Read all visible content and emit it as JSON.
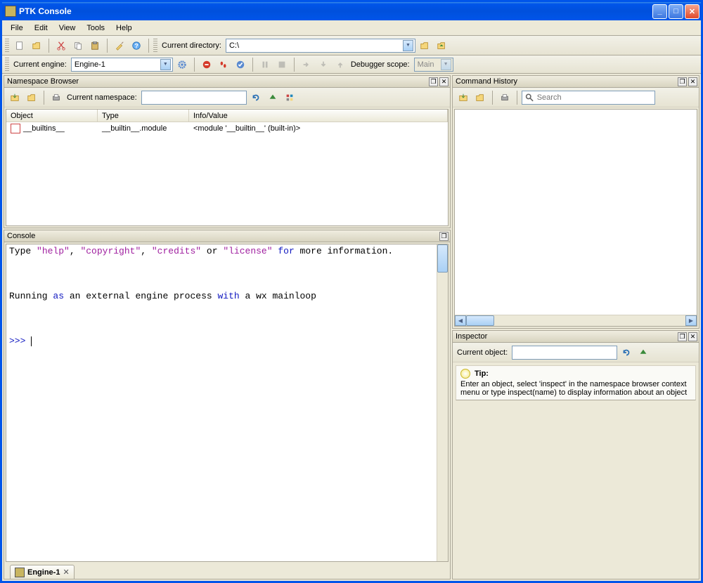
{
  "window": {
    "title": "PTK Console"
  },
  "menubar": [
    "File",
    "Edit",
    "View",
    "Tools",
    "Help"
  ],
  "toolbar1": {
    "current_directory_label": "Current directory:",
    "current_directory_value": "C:\\"
  },
  "toolbar2": {
    "current_engine_label": "Current engine:",
    "current_engine_value": "Engine-1",
    "debugger_scope_label": "Debugger scope:",
    "debugger_scope_value": "Main"
  },
  "namespace_browser": {
    "title": "Namespace Browser",
    "current_namespace_label": "Current namespace:",
    "current_namespace_value": "",
    "columns": [
      "Object",
      "Type",
      "Info/Value"
    ],
    "rows": [
      {
        "object": "__builtins__",
        "type": "__builtin__.module",
        "info": "<module '__builtin__' (built-in)>"
      }
    ]
  },
  "console": {
    "title": "Console",
    "tab_label": "Engine-1",
    "line1_prefix": "Type ",
    "line1_s1": "\"help\"",
    "line1_mid1": ", ",
    "line1_s2": "\"copyright\"",
    "line1_mid2": ", ",
    "line1_s3": "\"credits\"",
    "line1_mid3": " or ",
    "line1_s4": "\"license\"",
    "line1_mid4": " ",
    "line1_kw1": "for",
    "line1_suffix": " more information.",
    "line2_prefix": "Running ",
    "line2_kw1": "as",
    "line2_mid1": " an external engine process ",
    "line2_kw2": "with",
    "line2_suffix": " a wx mainloop",
    "prompt": ">>> "
  },
  "command_history": {
    "title": "Command History",
    "search_placeholder": "Search"
  },
  "inspector": {
    "title": "Inspector",
    "current_object_label": "Current object:",
    "current_object_value": "",
    "tip_label": "Tip:",
    "tip_text": "Enter an object, select 'inspect' in the namespace browser context menu or type inspect(name) to display information about an object"
  },
  "icons": {
    "new": "new-file-icon",
    "open": "open-folder-icon",
    "cut": "cut-icon",
    "copy": "copy-icon",
    "paste": "paste-icon",
    "clear": "clear-icon",
    "help": "help-icon",
    "folder": "folder-icon",
    "folder-up": "folder-up-icon",
    "gear": "gear-icon",
    "stop": "stop-icon",
    "pause": "pause-icon",
    "check": "check-icon",
    "step": "step-icon",
    "breakpoint": "breakpoint-icon",
    "refresh": "refresh-icon",
    "up": "up-arrow-icon"
  }
}
